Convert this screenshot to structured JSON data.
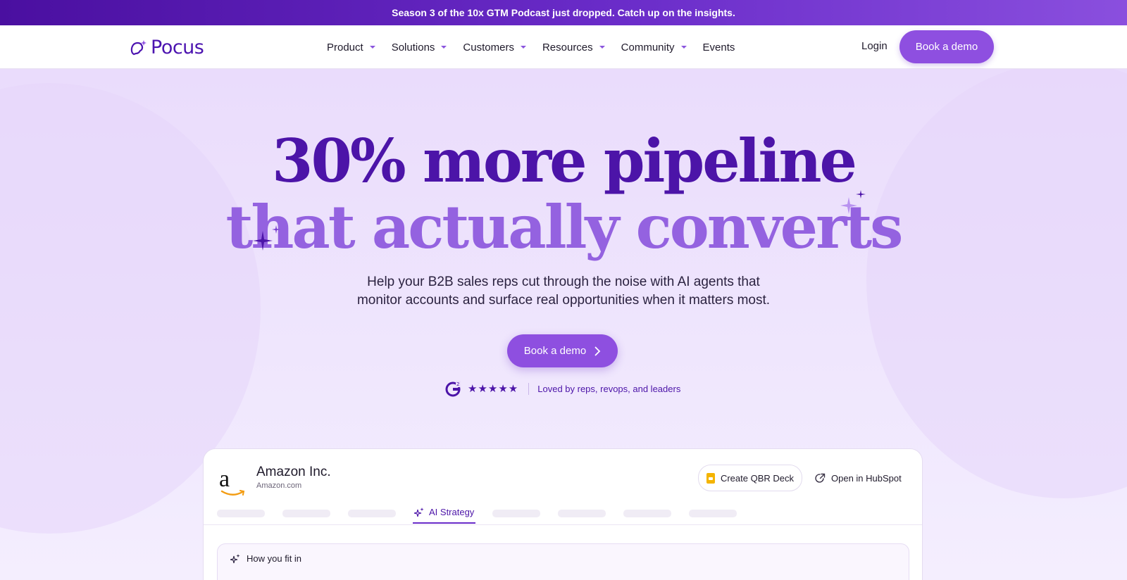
{
  "announcement": "Season 3 of the 10x GTM Podcast just dropped. Catch up on the insights.",
  "brand": {
    "name": "Pocus",
    "color": "#4c14b0",
    "accent": "#8e4fe0"
  },
  "nav": {
    "items": [
      {
        "label": "Product",
        "dropdown": true
      },
      {
        "label": "Solutions",
        "dropdown": true
      },
      {
        "label": "Customers",
        "dropdown": true
      },
      {
        "label": "Resources",
        "dropdown": true
      },
      {
        "label": "Community",
        "dropdown": true
      },
      {
        "label": "Events",
        "dropdown": false
      }
    ],
    "login": "Login",
    "cta": "Book a demo"
  },
  "hero": {
    "headline_1": "30% more pipeline",
    "headline_2": "that actually converts",
    "sub_1": "Help your B2B sales reps cut through the noise with AI agents that",
    "sub_2": "monitor accounts and surface real opportunities when it matters most.",
    "cta": "Book a demo",
    "rating": {
      "stars": "★★★★★",
      "text": "Loved by reps, revops, and leaders",
      "badge_icon": "g2-icon"
    }
  },
  "account_card": {
    "logo_letter": "a",
    "company": "Amazon Inc.",
    "url": "Amazon.com",
    "actions": {
      "qbr": "Create QBR Deck",
      "hubspot": "Open in HubSpot"
    },
    "active_tab": "AI Strategy",
    "panel_title": "How you fit in"
  }
}
